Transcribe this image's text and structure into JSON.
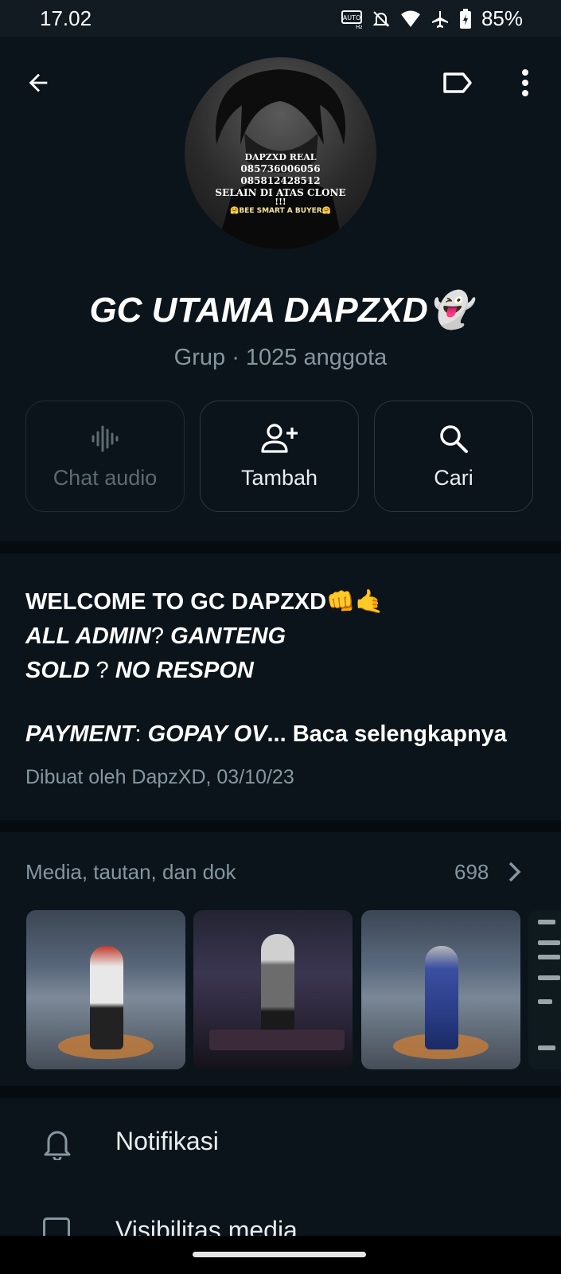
{
  "status": {
    "time": "17.02",
    "battery": "85%",
    "icons": [
      "auto-hz-icon",
      "mute-icon",
      "wifi-icon",
      "airplane-icon",
      "battery-icon"
    ]
  },
  "header": {
    "icons": [
      "back-arrow-icon",
      "label-tag-icon",
      "more-vert-icon"
    ]
  },
  "avatar": {
    "lines": [
      "DAPZXD REAL",
      "085736006056",
      "085812428512",
      "SELAIN DI ATAS CLONE",
      "!!!",
      "🤗BEE SMART A BUYER🤗"
    ]
  },
  "group": {
    "name": "GC UTAMA DAPZXD👻",
    "subtitle": "Grup · 1025 anggota"
  },
  "actions": [
    {
      "label": "Chat audio",
      "icon": "audio-wave-icon",
      "enabled": false
    },
    {
      "label": "Tambah",
      "icon": "add-person-icon",
      "enabled": true
    },
    {
      "label": "Cari",
      "icon": "search-icon",
      "enabled": true
    }
  ],
  "description": {
    "line1": "WELCOME TO GC DAPZXD👊🤙",
    "line2_a": "ALL  ADMIN",
    "line2_b": "?  ",
    "line2_c": "GANTENG",
    "line3_a": "SOLD  ",
    "line3_b": "?  ",
    "line3_c": "NO  RESPON",
    "line4_a": "PAYMENT",
    "line4_b": ": ",
    "line4_c": "GOPAY OV",
    "read_more": "... Baca selengkapnya",
    "created": "Dibuat oleh DapzXD, 03/10/23"
  },
  "media": {
    "title": "Media, tautan, dan dok",
    "count": "698"
  },
  "settings": [
    {
      "label": "Notifikasi",
      "icon": "bell-icon"
    },
    {
      "label": "Visibilitas media",
      "icon": "media-visibility-icon"
    }
  ],
  "colors": {
    "background": "#0b141a",
    "secondary_text": "#8696a0",
    "separator": "#050b0e"
  }
}
